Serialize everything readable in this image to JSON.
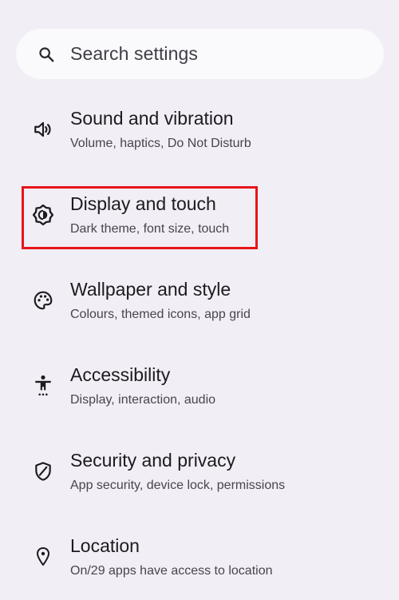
{
  "search": {
    "placeholder": "Search settings",
    "icon": "search-icon"
  },
  "items": [
    {
      "icon": "volume-icon",
      "title": "Sound and vibration",
      "subtitle": "Volume, haptics, Do Not Disturb"
    },
    {
      "icon": "brightness-icon",
      "title": "Display and touch",
      "subtitle": "Dark theme, font size, touch"
    },
    {
      "icon": "palette-icon",
      "title": "Wallpaper and style",
      "subtitle": "Colours, themed icons, app grid"
    },
    {
      "icon": "accessibility-icon",
      "title": "Accessibility",
      "subtitle": "Display, interaction, audio"
    },
    {
      "icon": "shield-icon",
      "title": "Security and privacy",
      "subtitle": "App security, device lock, permissions"
    },
    {
      "icon": "location-pin-icon",
      "title": "Location",
      "subtitle": "On/29 apps have access to location"
    }
  ],
  "highlight_color": "#E8141B"
}
